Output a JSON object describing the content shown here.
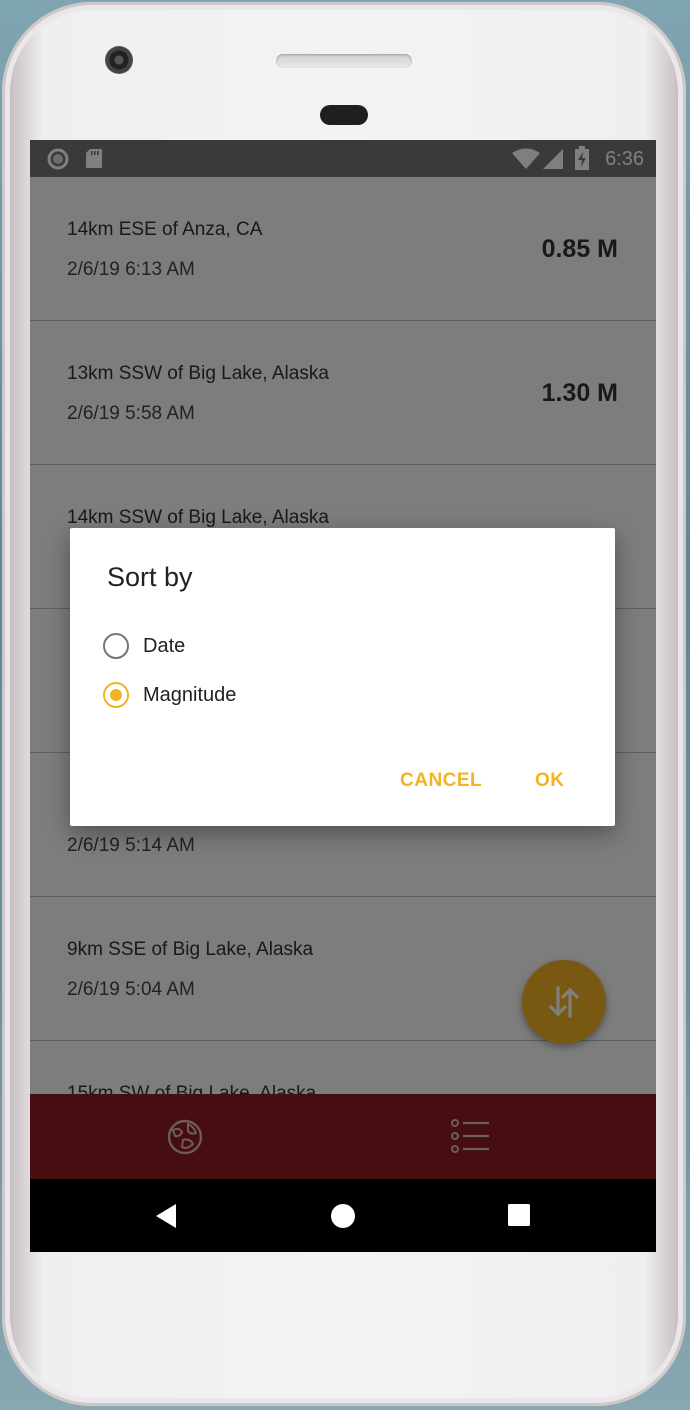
{
  "status_bar": {
    "time": "6:36",
    "left_icons": [
      "record-icon",
      "sd-card-icon"
    ],
    "right_icons": [
      "wifi-icon",
      "cell-signal-icon",
      "battery-charging-icon"
    ]
  },
  "earthquakes": [
    {
      "place": "14km ESE of Anza, CA",
      "time": "2/6/19 6:13 AM",
      "mag": "0.85 M"
    },
    {
      "place": "13km SSW of Big Lake, Alaska",
      "time": "2/6/19 5:58 AM",
      "mag": "1.30 M"
    },
    {
      "place": "14km SSW of Big Lake, Alaska",
      "time": "",
      "mag": ""
    },
    {
      "place": "",
      "time": "",
      "mag": ""
    },
    {
      "place": "",
      "time": "2/6/19 5:14 AM",
      "mag": ""
    },
    {
      "place": "9km SSE of Big Lake, Alaska",
      "time": "2/6/19 5:04 AM",
      "mag": ""
    },
    {
      "place": "15km SW of Big Lake, Alaska",
      "time": "",
      "mag": ""
    }
  ],
  "dialog": {
    "title": "Sort by",
    "options": [
      {
        "label": "Date",
        "selected": false
      },
      {
        "label": "Magnitude",
        "selected": true
      }
    ],
    "cancel_label": "CANCEL",
    "ok_label": "OK"
  },
  "fab_icon": "sort-icon",
  "bottom_nav": [
    {
      "icon": "globe-map-icon"
    },
    {
      "icon": "list-icon"
    }
  ],
  "system_nav": [
    "back-icon",
    "home-icon",
    "recents-icon"
  ],
  "colors": {
    "accent": "#f3b322",
    "nav_bar": "#8c1d23",
    "status_bar": "#757575"
  }
}
